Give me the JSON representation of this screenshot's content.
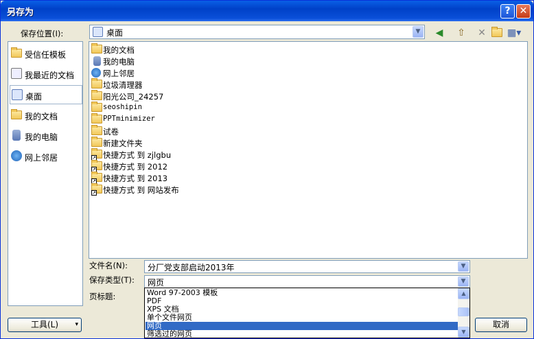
{
  "window": {
    "title": "另存为"
  },
  "title_buttons": {
    "help": "?",
    "close": "✕"
  },
  "save_location": {
    "label": "保存位置(I):",
    "value": "桌面",
    "arrow": "▼"
  },
  "toolbar_icons": [
    "back-icon",
    "up-folder-icon",
    "delete-icon",
    "new-folder-icon",
    "views-menu-icon"
  ],
  "places": [
    {
      "label": "受信任模板",
      "icon": "folder-icon",
      "selected": false
    },
    {
      "label": "我最近的文档",
      "icon": "recent-docs-icon",
      "selected": false
    },
    {
      "label": "桌面",
      "icon": "desktop-icon",
      "selected": true
    },
    {
      "label": "我的文档",
      "icon": "my-documents-icon",
      "selected": false
    },
    {
      "label": "我的电脑",
      "icon": "my-computer-icon",
      "selected": false
    },
    {
      "label": "网上邻居",
      "icon": "network-icon",
      "selected": false
    }
  ],
  "files": [
    {
      "name": "我的文档",
      "type": "my-documents"
    },
    {
      "name": "我的电脑",
      "type": "my-computer"
    },
    {
      "name": "网上邻居",
      "type": "network"
    },
    {
      "name": "垃圾清理器",
      "type": "folder"
    },
    {
      "name": "阳光公司_24257",
      "type": "folder"
    },
    {
      "name": "seoshipin",
      "type": "folder"
    },
    {
      "name": "PPTminimizer",
      "type": "folder"
    },
    {
      "name": "试卷",
      "type": "folder"
    },
    {
      "name": "新建文件夹",
      "type": "folder"
    },
    {
      "name": "快捷方式 到 zjlgbu",
      "type": "shortcut"
    },
    {
      "name": "快捷方式 到 2012",
      "type": "shortcut"
    },
    {
      "name": "快捷方式 到 2013",
      "type": "shortcut"
    },
    {
      "name": "快捷方式 到 网站发布",
      "type": "shortcut"
    }
  ],
  "filename": {
    "label": "文件名(N):",
    "value": "分厂党支部启动2013年"
  },
  "filetype": {
    "label": "保存类型(T):",
    "value": "网页",
    "options": [
      "Word 97-2003 模板",
      "PDF",
      "XPS 文档",
      "单个文件网页",
      "网页",
      "筛选过的网页"
    ],
    "selected_index": 4
  },
  "page_title": {
    "label": "页标题:"
  },
  "buttons": {
    "tools": "工具(L)",
    "tools_arrow": "▾",
    "cancel": "取消"
  }
}
